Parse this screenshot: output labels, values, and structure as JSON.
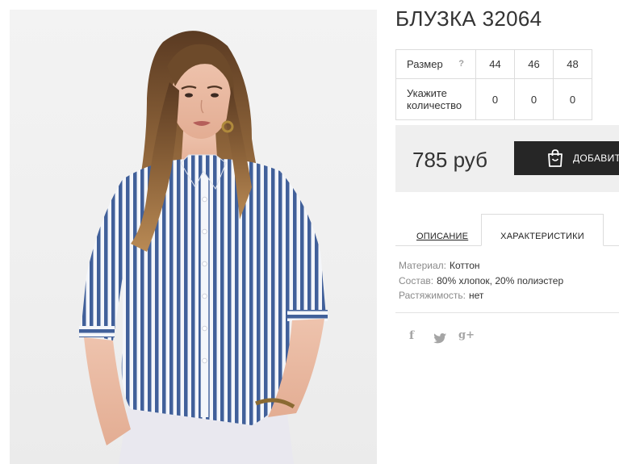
{
  "product": {
    "title": "БЛУЗКА 32064"
  },
  "size_table": {
    "size_label": "Размер",
    "help_label": "?",
    "sizes": [
      "44",
      "46",
      "48"
    ],
    "qty_label": "Укажите количество",
    "quantities": [
      "0",
      "0",
      "0"
    ]
  },
  "price": {
    "value": "785 руб",
    "add_button_label": "ДОБАВИТЬ",
    "add_button_icon": "shopping-bag-icon"
  },
  "tabs": [
    {
      "label": "ОПИСАНИЕ",
      "active": false
    },
    {
      "label": "ХАРАКТЕРИСТИКИ",
      "active": true
    }
  ],
  "characteristics": [
    {
      "key": "Материал:",
      "value": "Коттон"
    },
    {
      "key": "Состав:",
      "value": "80% хлопок, 20% полиэстер"
    },
    {
      "key": "Растяжимость:",
      "value": "нет"
    }
  ],
  "social": {
    "facebook": "f",
    "twitter": "twitter-bird-icon",
    "googleplus": "g+"
  },
  "colors": {
    "button_bg": "#262626",
    "price_box_bg": "#efefef",
    "border": "#dcdcdc",
    "stripe": "#3f5d95"
  }
}
